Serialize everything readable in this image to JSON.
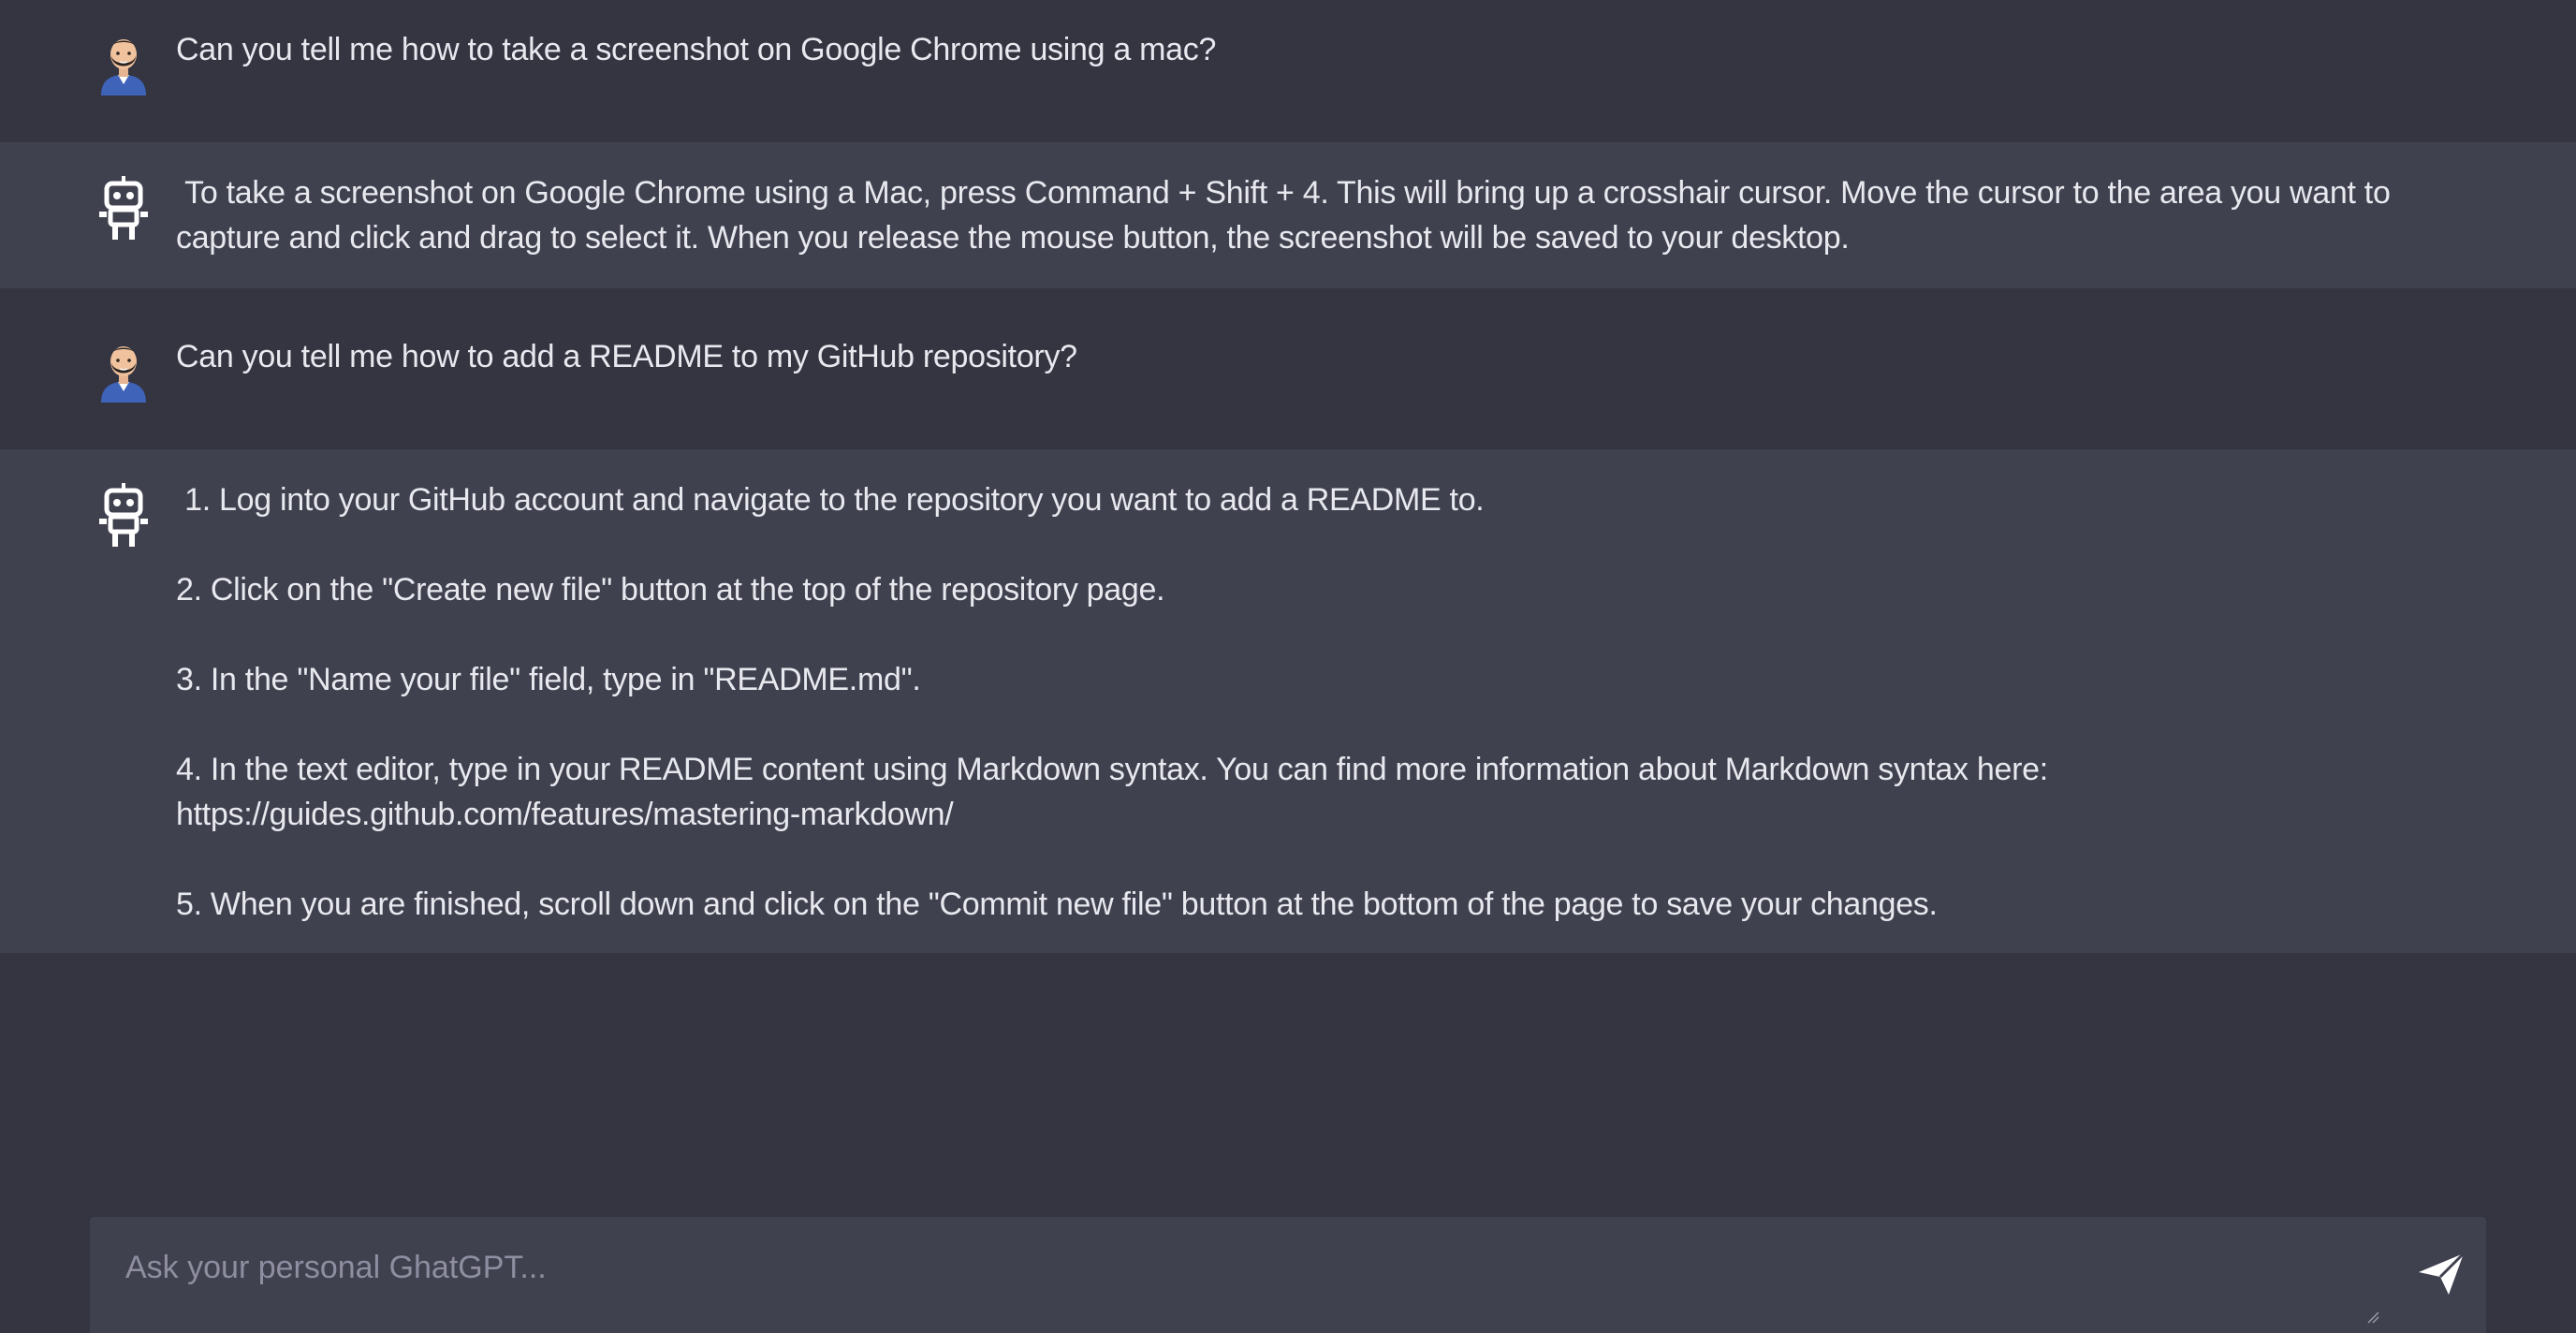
{
  "conversation": {
    "messages": [
      {
        "role": "user",
        "avatar_icon": "user-avatar-icon",
        "text": "Can you tell me how to take a screenshot on Google Chrome using a mac?"
      },
      {
        "role": "bot",
        "avatar_icon": "robot-icon",
        "text": " To take a screenshot on Google Chrome using a Mac, press Command + Shift + 4. This will bring up a crosshair cursor. Move the cursor to the area you want to capture and click and drag to select it. When you release the mouse button, the screenshot will be saved to your desktop."
      },
      {
        "role": "user",
        "avatar_icon": "user-avatar-icon",
        "text": "Can you tell me how to add a README to my GitHub repository?"
      },
      {
        "role": "bot",
        "avatar_icon": "robot-icon",
        "paragraphs": [
          " 1. Log into your GitHub account and navigate to the repository you want to add a README to.",
          "2. Click on the \"Create new file\" button at the top of the repository page.",
          "3. In the \"Name your file\" field, type in \"README.md\".",
          "4. In the text editor, type in your README content using Markdown syntax. You can find more information about Markdown syntax here: https://guides.github.com/features/mastering-markdown/",
          "5. When you are finished, scroll down and click on the \"Commit new file\" button at the bottom of the page to save your changes."
        ]
      }
    ]
  },
  "composer": {
    "placeholder": "Ask your personal GhatGPT...",
    "value": "",
    "send_icon": "send-icon"
  },
  "colors": {
    "background": "#343541",
    "bot_message_background": "#40414f",
    "text": "#e8e8ef",
    "placeholder": "#8e8ea0"
  }
}
